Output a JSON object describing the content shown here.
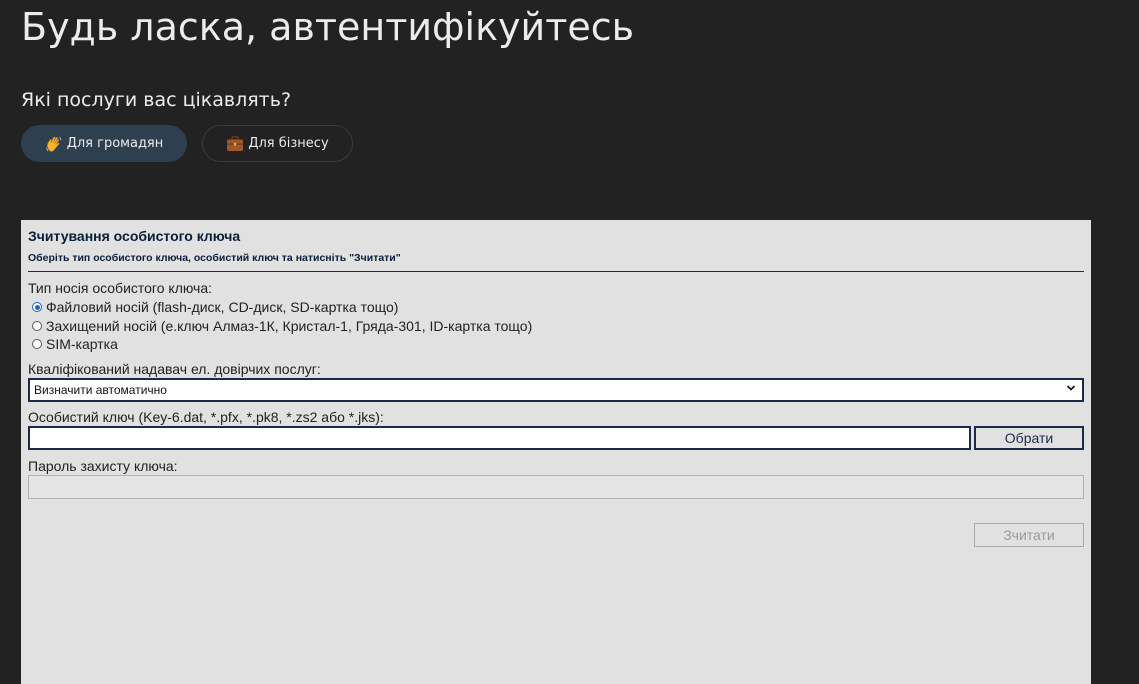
{
  "header": {
    "title": "Будь ласка, автентифікуйтесь",
    "services_question": "Які послуги вас цікавлять?",
    "buttons": [
      {
        "label": "Для громадян",
        "icon": "waving-hand-icon",
        "active": true
      },
      {
        "label": "Для бізнесу",
        "icon": "briefcase-icon",
        "active": false
      }
    ]
  },
  "key_form": {
    "title": "Зчитування особистого ключа",
    "subtitle": "Оберіть тип особистого ключа, особистий ключ та натисніть \"Зчитати\"",
    "media_type_label": "Тип носія особистого ключа:",
    "media_options": [
      {
        "label": "Файловий носій (flash-диск, CD-диск, SD-картка тощо)",
        "checked": true
      },
      {
        "label": "Захищений носій (е.ключ Алмаз-1К, Кристал-1, Гряда-301, ID-картка тощо)",
        "checked": false
      },
      {
        "label": "SIM-картка",
        "checked": false
      }
    ],
    "provider_label": "Кваліфікований надавач ел. довірчих послуг:",
    "provider_value": "Визначити автоматично",
    "key_file_label": "Особистий ключ (Key-6.dat, *.pfx, *.pk8, *.zs2 або *.jks):",
    "key_file_value": "",
    "choose_button": "Обрати",
    "password_label": "Пароль захисту ключа:",
    "password_value": "",
    "read_button": "Зчитати"
  },
  "colors": {
    "page_bg": "#222222",
    "active_button_bg": "#2e3f50",
    "panel_bg": "#e1e1e1",
    "accent_navy": "#1b2a4a"
  }
}
